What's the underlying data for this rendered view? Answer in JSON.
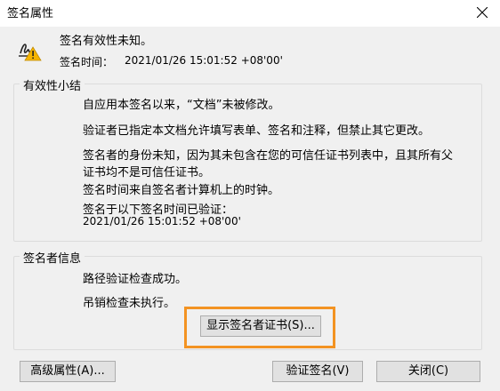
{
  "window": {
    "title": "签名属性"
  },
  "signature": {
    "status": "签名有效性未知。",
    "time_label": "签名时间：",
    "time_value": "2021/01/26 15:01:52 +08'00'"
  },
  "validity_summary": {
    "legend": "有效性小结",
    "lines": [
      "自应用本签名以来，“文档”未被修改。",
      "验证者已指定本文档允许填写表单、签名和注释，但禁止其它更改。",
      "签名者的身份未知，因为其未包含在您的可信任证书列表中，且其所有父",
      "证书均不是可信任证书。",
      "签名时间来自签名者计算机上的时钟。",
      "签名于以下签名时间已验证：",
      "2021/01/26 15:01:52 +08'00'"
    ]
  },
  "signer_info": {
    "legend": "签名者信息",
    "lines": [
      "路径验证检查成功。",
      "吊销检查未执行。"
    ],
    "show_cert_button": "显示签名者证书(S)..."
  },
  "buttons": {
    "advanced": "高级属性(A)...",
    "verify": "验证签名(V)",
    "close": "关闭(C)"
  },
  "colors": {
    "highlight": "#f39322",
    "warning": "#f5b400"
  },
  "icons": {
    "signature_warning": "signature-warning-icon",
    "close": "close-icon"
  }
}
